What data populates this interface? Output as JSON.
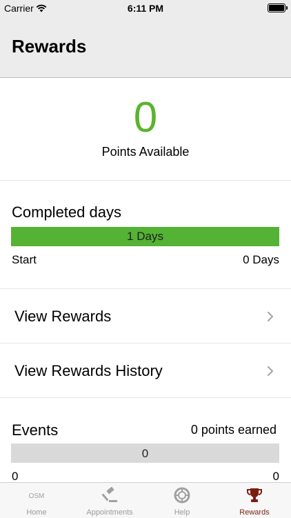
{
  "status_bar": {
    "carrier": "Carrier",
    "time": "6:11 PM",
    "icons": [
      "wifi-icon",
      "battery-icon"
    ]
  },
  "nav": {
    "title": "Rewards"
  },
  "points": {
    "value": "0",
    "label": "Points Available",
    "color": "#58b52c"
  },
  "completed": {
    "title": "Completed days",
    "bar_label": "1 Days",
    "bar_fill": 1.0,
    "bar_color": "#54b234",
    "start_label": "Start",
    "end_label": "0 Days"
  },
  "menu": [
    {
      "label": "View Rewards",
      "icon": "chevron-right-icon"
    },
    {
      "label": "View Rewards History",
      "icon": "chevron-right-icon"
    }
  ],
  "events": {
    "title": "Events",
    "earned": "0 points earned",
    "bar_label": "0",
    "bar_color": "#d9d9d9",
    "start": "0",
    "end": "0"
  },
  "tabs": [
    {
      "label": "Home",
      "icon": "osm-logo",
      "logo_text": "OSM"
    },
    {
      "label": "Appointments",
      "icon": "gavel-icon"
    },
    {
      "label": "Help",
      "icon": "lifebuoy-icon"
    },
    {
      "label": "Rewards",
      "icon": "trophy-icon",
      "active": true,
      "active_color": "#7a1e12"
    }
  ]
}
